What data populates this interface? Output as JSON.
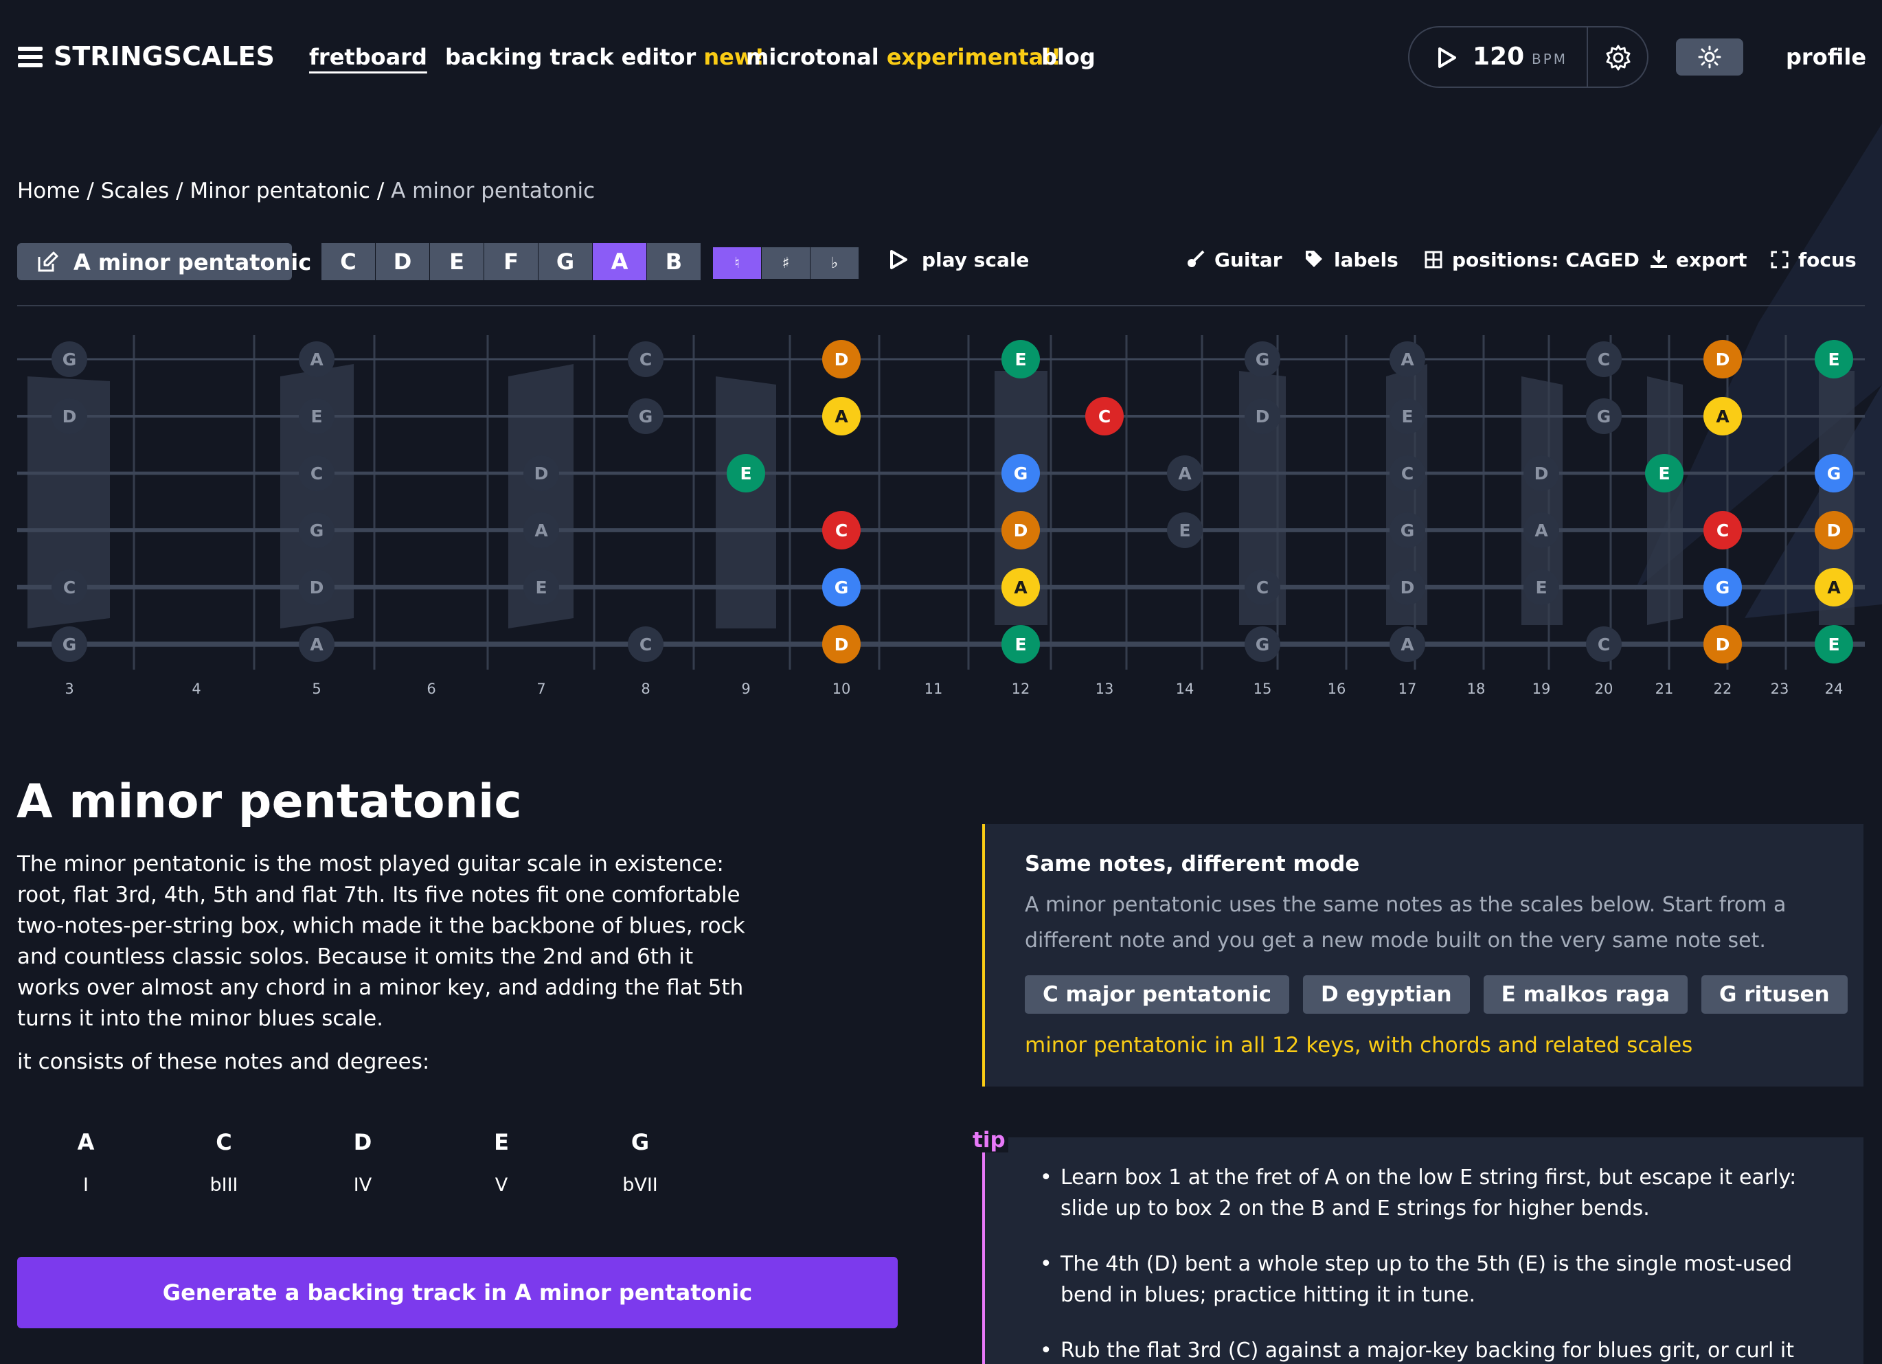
{
  "nav": {
    "logo": "STRINGSCALES",
    "links": [
      {
        "label": "fretboard",
        "badge": ""
      },
      {
        "label": "backing track editor",
        "badge": "new!"
      },
      {
        "label": "microtonal",
        "badge": "experimental!"
      },
      {
        "label": "blog",
        "badge": ""
      }
    ],
    "bpm": "120",
    "bpm_unit": "BPM",
    "profile": "profile"
  },
  "breadcrumb": {
    "items": [
      "Home",
      "Scales",
      "Minor pentatonic"
    ],
    "current": "A minor pentatonic",
    "separator": " / "
  },
  "toolbar": {
    "scale_name": "A minor pentatonic",
    "keys": [
      "C",
      "D",
      "E",
      "F",
      "G",
      "A",
      "B"
    ],
    "selected_key": "A",
    "accidentals": [
      "♮",
      "♯",
      "♭"
    ],
    "selected_accidental": "♮",
    "play": "play scale",
    "instrument": "Guitar",
    "labels": "labels",
    "positions": "positions: CAGED",
    "export": "export",
    "focus": "focus"
  },
  "fretboard": {
    "fret_numbers": [
      "3",
      "4",
      "5",
      "6",
      "7",
      "8",
      "9",
      "10",
      "11",
      "12",
      "13",
      "14",
      "15",
      "16",
      "17",
      "18",
      "19",
      "20",
      "21",
      "22",
      "23",
      "24"
    ],
    "colors": {
      "A": "#facc15",
      "C": "#dc2626",
      "D": "#d97706",
      "E": "#059669",
      "G": "#3b82f6",
      "ghost": "#2b3344",
      "ghost_text": "#8b93a3"
    },
    "notes": [
      {
        "s": 0,
        "f": 3,
        "n": "G",
        "hl": false
      },
      {
        "s": 1,
        "f": 3,
        "n": "D",
        "hl": false
      },
      {
        "s": 4,
        "f": 3,
        "n": "C",
        "hl": false
      },
      {
        "s": 5,
        "f": 3,
        "n": "G",
        "hl": false
      },
      {
        "s": 0,
        "f": 5,
        "n": "A",
        "hl": false
      },
      {
        "s": 1,
        "f": 5,
        "n": "E",
        "hl": false
      },
      {
        "s": 2,
        "f": 5,
        "n": "C",
        "hl": false
      },
      {
        "s": 3,
        "f": 5,
        "n": "G",
        "hl": false
      },
      {
        "s": 4,
        "f": 5,
        "n": "D",
        "hl": false
      },
      {
        "s": 5,
        "f": 5,
        "n": "A",
        "hl": false
      },
      {
        "s": 2,
        "f": 7,
        "n": "D",
        "hl": false
      },
      {
        "s": 3,
        "f": 7,
        "n": "A",
        "hl": false
      },
      {
        "s": 4,
        "f": 7,
        "n": "E",
        "hl": false
      },
      {
        "s": 0,
        "f": 8,
        "n": "C",
        "hl": false
      },
      {
        "s": 1,
        "f": 8,
        "n": "G",
        "hl": false
      },
      {
        "s": 5,
        "f": 8,
        "n": "C",
        "hl": false
      },
      {
        "s": 2,
        "f": 9,
        "n": "E",
        "hl": true
      },
      {
        "s": 0,
        "f": 10,
        "n": "D",
        "hl": true
      },
      {
        "s": 1,
        "f": 10,
        "n": "A",
        "hl": true
      },
      {
        "s": 3,
        "f": 10,
        "n": "C",
        "hl": true
      },
      {
        "s": 4,
        "f": 10,
        "n": "G",
        "hl": true
      },
      {
        "s": 5,
        "f": 10,
        "n": "D",
        "hl": true
      },
      {
        "s": 0,
        "f": 12,
        "n": "E",
        "hl": true
      },
      {
        "s": 2,
        "f": 12,
        "n": "G",
        "hl": true
      },
      {
        "s": 3,
        "f": 12,
        "n": "D",
        "hl": true
      },
      {
        "s": 4,
        "f": 12,
        "n": "A",
        "hl": true
      },
      {
        "s": 5,
        "f": 12,
        "n": "E",
        "hl": true
      },
      {
        "s": 1,
        "f": 13,
        "n": "C",
        "hl": true
      },
      {
        "s": 2,
        "f": 14,
        "n": "A",
        "hl": false
      },
      {
        "s": 3,
        "f": 14,
        "n": "E",
        "hl": false
      },
      {
        "s": 0,
        "f": 15,
        "n": "G",
        "hl": false
      },
      {
        "s": 1,
        "f": 15,
        "n": "D",
        "hl": false
      },
      {
        "s": 4,
        "f": 15,
        "n": "C",
        "hl": false
      },
      {
        "s": 5,
        "f": 15,
        "n": "G",
        "hl": false
      },
      {
        "s": 0,
        "f": 17,
        "n": "A",
        "hl": false
      },
      {
        "s": 1,
        "f": 17,
        "n": "E",
        "hl": false
      },
      {
        "s": 2,
        "f": 17,
        "n": "C",
        "hl": false
      },
      {
        "s": 3,
        "f": 17,
        "n": "G",
        "hl": false
      },
      {
        "s": 4,
        "f": 17,
        "n": "D",
        "hl": false
      },
      {
        "s": 5,
        "f": 17,
        "n": "A",
        "hl": false
      },
      {
        "s": 2,
        "f": 19,
        "n": "D",
        "hl": false
      },
      {
        "s": 3,
        "f": 19,
        "n": "A",
        "hl": false
      },
      {
        "s": 4,
        "f": 19,
        "n": "E",
        "hl": false
      },
      {
        "s": 0,
        "f": 20,
        "n": "C",
        "hl": false
      },
      {
        "s": 1,
        "f": 20,
        "n": "G",
        "hl": false
      },
      {
        "s": 5,
        "f": 20,
        "n": "C",
        "hl": false
      },
      {
        "s": 2,
        "f": 21,
        "n": "E",
        "hl": true
      },
      {
        "s": 0,
        "f": 22,
        "n": "D",
        "hl": true
      },
      {
        "s": 1,
        "f": 22,
        "n": "A",
        "hl": true
      },
      {
        "s": 3,
        "f": 22,
        "n": "C",
        "hl": true
      },
      {
        "s": 4,
        "f": 22,
        "n": "G",
        "hl": true
      },
      {
        "s": 5,
        "f": 22,
        "n": "D",
        "hl": true
      },
      {
        "s": 0,
        "f": 24,
        "n": "E",
        "hl": true
      },
      {
        "s": 2,
        "f": 24,
        "n": "G",
        "hl": true
      },
      {
        "s": 3,
        "f": 24,
        "n": "D",
        "hl": true
      },
      {
        "s": 4,
        "f": 24,
        "n": "A",
        "hl": true
      },
      {
        "s": 5,
        "f": 24,
        "n": "E",
        "hl": true
      }
    ]
  },
  "main": {
    "title": "A minor pentatonic",
    "intro": "The minor pentatonic is the most played guitar scale in existence: root, flat 3rd, 4th, 5th and flat 7th. Its five notes fit one comfortable two-notes-per-string box, which made it the backbone of blues, rock and countless classic solos. Because it omits the 2nd and 6th it works over almost any chord in a minor key, and adding the flat 5th turns it into the minor blues scale.",
    "consists": "it consists of these notes and degrees:",
    "degrees": [
      {
        "note": "A",
        "roman": "I"
      },
      {
        "note": "C",
        "roman": "bIII"
      },
      {
        "note": "D",
        "roman": "IV"
      },
      {
        "note": "E",
        "roman": "V"
      },
      {
        "note": "G",
        "roman": "bVII"
      }
    ],
    "generate": "Generate a backing track in A minor pentatonic"
  },
  "modes_card": {
    "title": "Same notes, different mode",
    "desc": "A minor pentatonic uses the same notes as the scales below. Start from a different note and you get a new mode built on the very same note set.",
    "chips": [
      "C major pentatonic",
      "D egyptian",
      "E malkos raga",
      "G ritusen"
    ],
    "link": "minor pentatonic in all 12 keys, with chords and related scales"
  },
  "tip": {
    "label": "tip",
    "items": [
      "Learn box 1 at the fret of A on the low E string first, but escape it early: slide up to box 2 on the B and E strings for higher bends.",
      "The 4th (D) bent a whole step up to the 5th (E) is the single most-used bend in blues; practice hitting it in tune.",
      "Rub the flat 3rd (C) against a major-key backing for blues grit, or curl it"
    ]
  }
}
